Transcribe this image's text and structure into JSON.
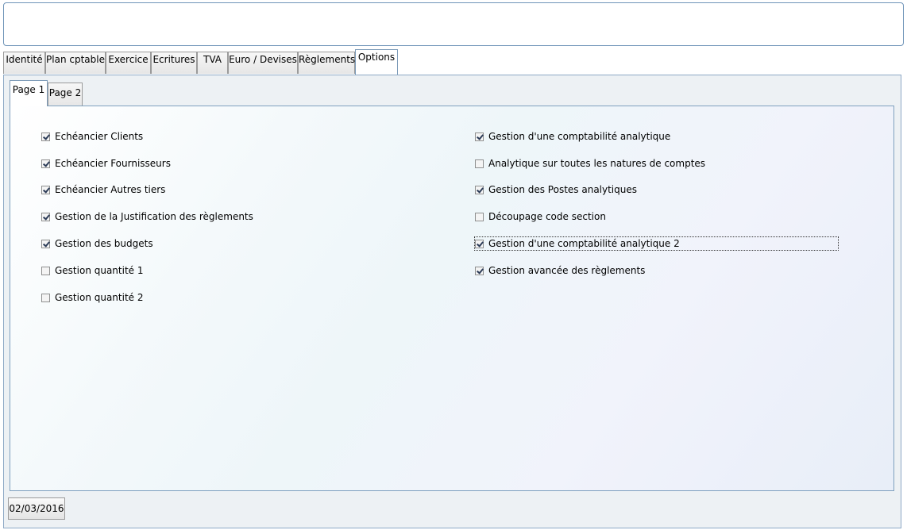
{
  "tabs": [
    {
      "label": "Identité"
    },
    {
      "label": "Plan cptable"
    },
    {
      "label": "Exercice"
    },
    {
      "label": "Ecritures"
    },
    {
      "label": "TVA"
    },
    {
      "label": "Euro / Devises"
    },
    {
      "label": "Règlements"
    },
    {
      "label": "Options"
    }
  ],
  "subtabs": [
    {
      "label": "Page 1"
    },
    {
      "label": "Page 2"
    }
  ],
  "left_options": [
    {
      "label": "Echéancier Clients",
      "checked": true
    },
    {
      "label": "Echéancier Fournisseurs",
      "checked": true
    },
    {
      "label": "Echéancier Autres tiers",
      "checked": true
    },
    {
      "label": "Gestion de la Justification des règlements",
      "checked": true
    },
    {
      "label": "Gestion des budgets",
      "checked": true
    },
    {
      "label": "Gestion quantité 1",
      "checked": false
    },
    {
      "label": "Gestion quantité 2",
      "checked": false
    }
  ],
  "right_options": [
    {
      "label": "Gestion d'une comptabilité analytique",
      "checked": true
    },
    {
      "label": "Analytique sur toutes les natures de comptes",
      "checked": false
    },
    {
      "label": "Gestion des Postes analytiques",
      "checked": true
    },
    {
      "label": "Découpage code section",
      "checked": false
    },
    {
      "label": "Gestion d'une comptabilité analytique 2",
      "checked": true
    },
    {
      "label": "Gestion avancée des règlements",
      "checked": true
    }
  ],
  "status": {
    "date": "02/03/2016"
  }
}
